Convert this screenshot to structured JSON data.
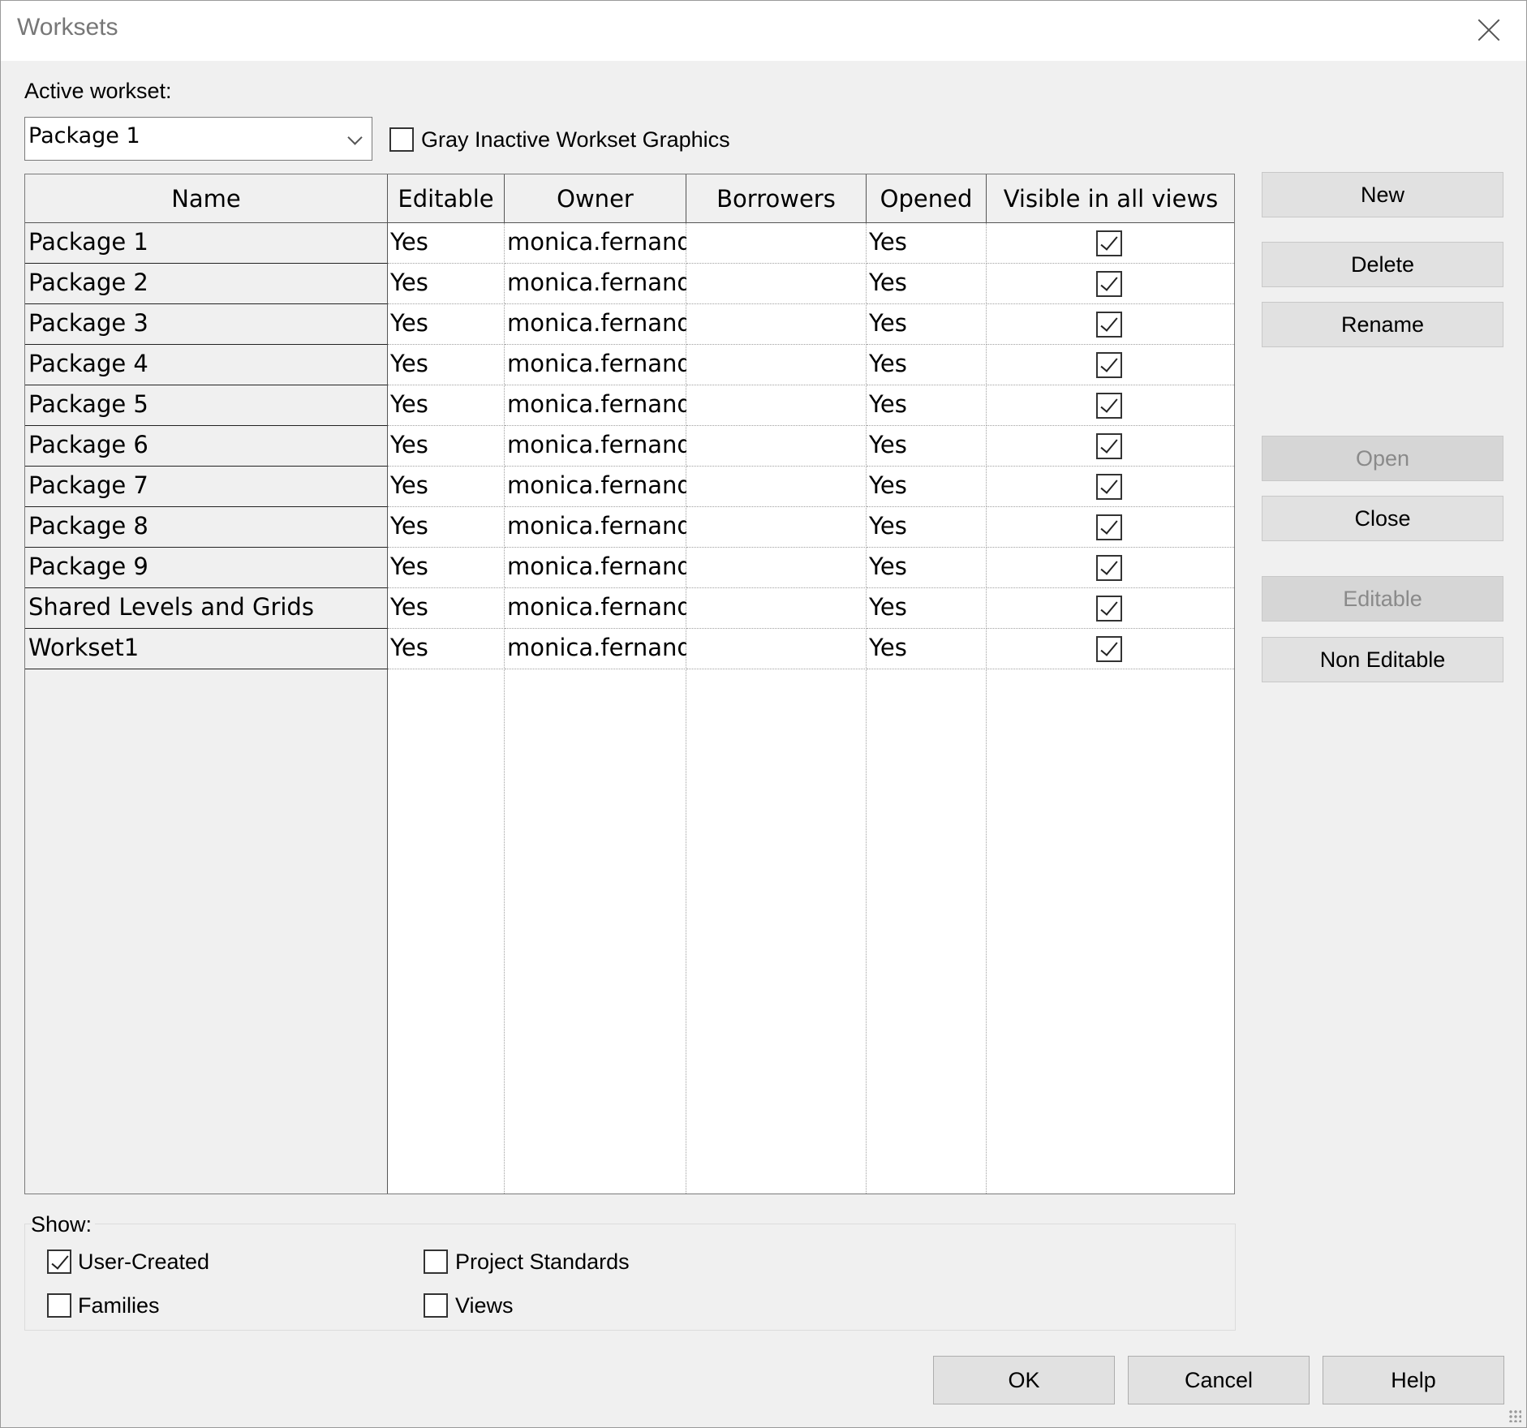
{
  "window": {
    "title": "Worksets"
  },
  "active_workset": {
    "label": "Active workset:",
    "value": "Package 1"
  },
  "gray_inactive": {
    "label": "Gray Inactive Workset Graphics",
    "checked": false
  },
  "table": {
    "columns": [
      "Name",
      "Editable",
      "Owner",
      "Borrowers",
      "Opened",
      "Visible in all views"
    ],
    "rows": [
      {
        "name": "Package 1",
        "editable": "Yes",
        "owner": "monica.fernand",
        "borrowers": "",
        "opened": "Yes",
        "visible": true
      },
      {
        "name": "Package 2",
        "editable": "Yes",
        "owner": "monica.fernand",
        "borrowers": "",
        "opened": "Yes",
        "visible": true
      },
      {
        "name": "Package 3",
        "editable": "Yes",
        "owner": "monica.fernand",
        "borrowers": "",
        "opened": "Yes",
        "visible": true
      },
      {
        "name": "Package 4",
        "editable": "Yes",
        "owner": "monica.fernand",
        "borrowers": "",
        "opened": "Yes",
        "visible": true
      },
      {
        "name": "Package 5",
        "editable": "Yes",
        "owner": "monica.fernand",
        "borrowers": "",
        "opened": "Yes",
        "visible": true
      },
      {
        "name": "Package 6",
        "editable": "Yes",
        "owner": "monica.fernand",
        "borrowers": "",
        "opened": "Yes",
        "visible": true
      },
      {
        "name": "Package 7",
        "editable": "Yes",
        "owner": "monica.fernand",
        "borrowers": "",
        "opened": "Yes",
        "visible": true
      },
      {
        "name": "Package 8",
        "editable": "Yes",
        "owner": "monica.fernand",
        "borrowers": "",
        "opened": "Yes",
        "visible": true
      },
      {
        "name": "Package 9",
        "editable": "Yes",
        "owner": "monica.fernand",
        "borrowers": "",
        "opened": "Yes",
        "visible": true
      },
      {
        "name": "Shared Levels and Grids",
        "editable": "Yes",
        "owner": "monica.fernand",
        "borrowers": "",
        "opened": "Yes",
        "visible": true
      },
      {
        "name": "Workset1",
        "editable": "Yes",
        "owner": "monica.fernand",
        "borrowers": "",
        "opened": "Yes",
        "visible": true
      }
    ]
  },
  "side_buttons": {
    "new": "New",
    "delete": "Delete",
    "rename": "Rename",
    "open": "Open",
    "close": "Close",
    "editable": "Editable",
    "non_editable": "Non Editable"
  },
  "disabled_buttons": [
    "open",
    "editable"
  ],
  "show": {
    "label": "Show:",
    "user_created": {
      "label": "User-Created",
      "checked": true
    },
    "project_standards": {
      "label": "Project Standards",
      "checked": false
    },
    "families": {
      "label": "Families",
      "checked": false
    },
    "views": {
      "label": "Views",
      "checked": false
    }
  },
  "footer": {
    "ok": "OK",
    "cancel": "Cancel",
    "help": "Help"
  }
}
